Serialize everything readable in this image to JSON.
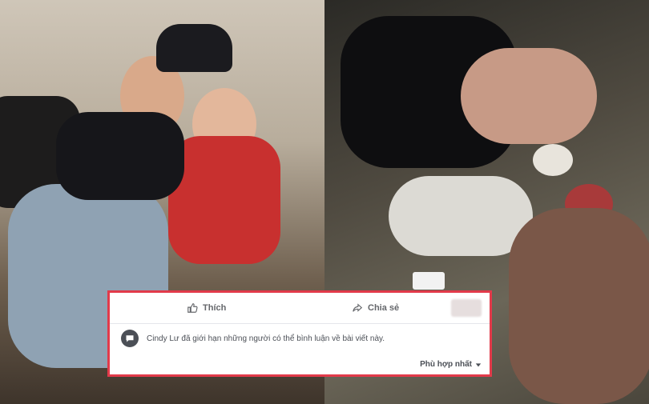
{
  "photos": {
    "left": {
      "description_icon": "family-photo"
    },
    "right": {
      "description_icon": "scuffle-photo"
    }
  },
  "post_actions": {
    "like_label": "Thích",
    "share_label": "Chia sẻ"
  },
  "comment_notice": {
    "text": "Cindy Lư đã giới hạn những người có thể bình luận về bài viết này."
  },
  "sort": {
    "label": "Phù hợp nhất"
  },
  "colors": {
    "border": "#e23a4a",
    "muted_text": "#65676b"
  }
}
